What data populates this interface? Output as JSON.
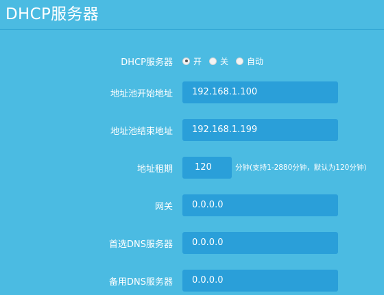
{
  "page": {
    "title": "DHCP服务器"
  },
  "dhcp_server": {
    "label": "DHCP服务器",
    "options": [
      {
        "label": "开",
        "checked": true
      },
      {
        "label": "关",
        "checked": false
      },
      {
        "label": "自动",
        "checked": false
      }
    ]
  },
  "pool_start": {
    "label": "地址池开始地址",
    "value": "192.168.1.100"
  },
  "pool_end": {
    "label": "地址池结束地址",
    "value": "192.168.1.199"
  },
  "lease": {
    "label": "地址租期",
    "value": "120",
    "hint": "分钟(支持1-2880分钟，默认为120分钟)"
  },
  "gateway": {
    "label": "网关",
    "value": "0.0.0.0"
  },
  "primary_dns": {
    "label": "首选DNS服务器",
    "value": "0.0.0.0"
  },
  "secondary_dns": {
    "label": "备用DNS服务器",
    "value": "0.0.0.0"
  },
  "colors": {
    "background": "#4bbbe2",
    "input_background": "#2a9fd9",
    "divider": "#2a9fd0",
    "text": "#ffffff"
  }
}
